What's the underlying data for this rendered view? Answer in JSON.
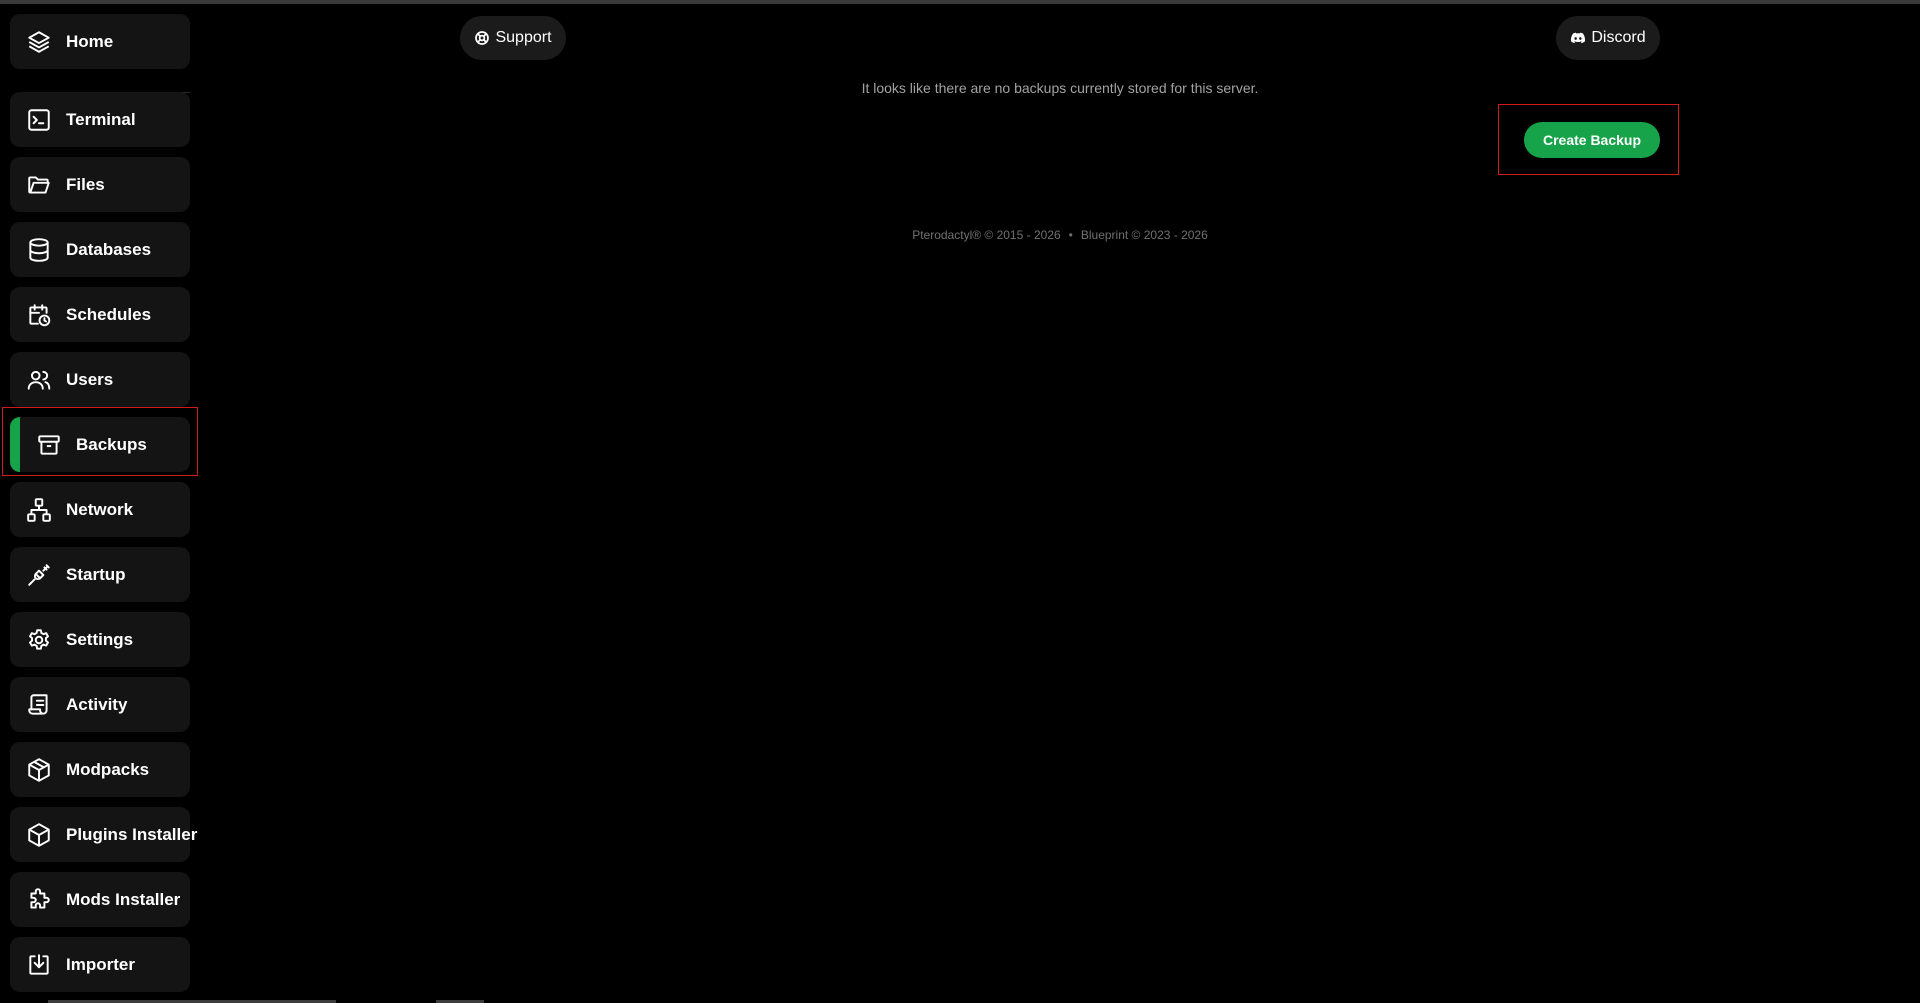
{
  "sidebar": {
    "items": [
      {
        "label": "Home",
        "icon": "layers-icon",
        "active": false
      },
      {
        "label": "Terminal",
        "icon": "terminal-icon",
        "active": false
      },
      {
        "label": "Files",
        "icon": "folder-icon",
        "active": false
      },
      {
        "label": "Databases",
        "icon": "database-icon",
        "active": false
      },
      {
        "label": "Schedules",
        "icon": "calendar-clock-icon",
        "active": false
      },
      {
        "label": "Users",
        "icon": "users-icon",
        "active": false
      },
      {
        "label": "Backups",
        "icon": "archive-icon",
        "active": true
      },
      {
        "label": "Network",
        "icon": "network-icon",
        "active": false
      },
      {
        "label": "Startup",
        "icon": "plug-icon",
        "active": false
      },
      {
        "label": "Settings",
        "icon": "gear-icon",
        "active": false
      },
      {
        "label": "Activity",
        "icon": "scroll-icon",
        "active": false
      },
      {
        "label": "Modpacks",
        "icon": "package-icon",
        "active": false
      },
      {
        "label": "Plugins Installer",
        "icon": "box-icon",
        "active": false
      },
      {
        "label": "Mods Installer",
        "icon": "puzzle-icon",
        "active": false
      },
      {
        "label": "Importer",
        "icon": "import-icon",
        "active": false
      }
    ]
  },
  "header": {
    "support_label": "Support",
    "discord_label": "Discord"
  },
  "main": {
    "empty_message": "It looks like there are no backups currently stored for this server.",
    "create_backup_label": "Create Backup"
  },
  "footer": {
    "pterodactyl": "Pterodactyl® © 2015 - 2026",
    "separator": "•",
    "blueprint": "Blueprint © 2023 - 2026"
  },
  "colors": {
    "accent": "#16a34a",
    "background": "#000000",
    "card": "#141414",
    "highlight_outline": "#d11a1a"
  }
}
